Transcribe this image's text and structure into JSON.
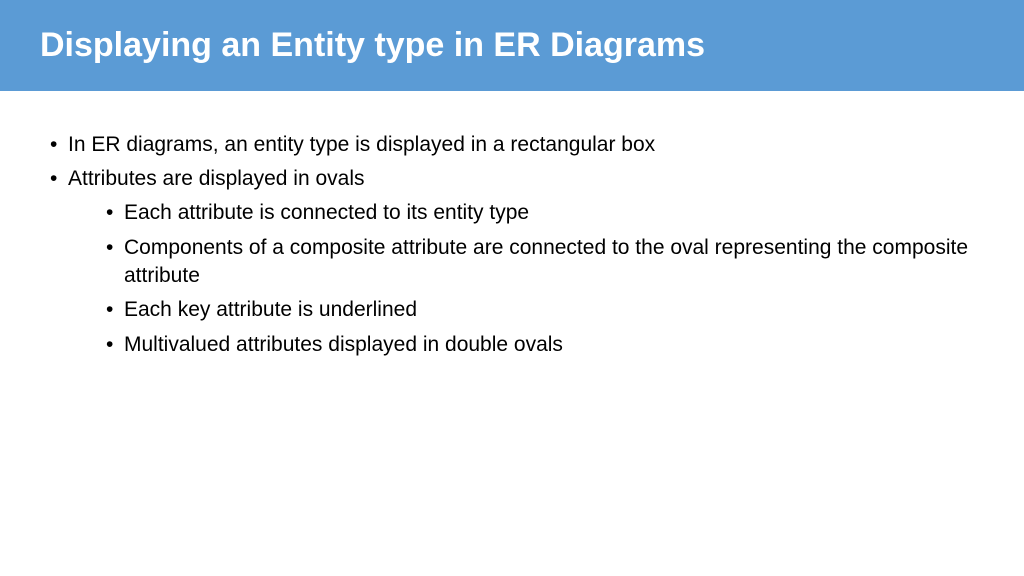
{
  "header": {
    "title": "Displaying an Entity type in ER Diagrams"
  },
  "content": {
    "bullets": [
      {
        "text": "In ER diagrams, an entity type is displayed in a rectangular box"
      },
      {
        "text": "Attributes are displayed in ovals",
        "subbullets": [
          "Each attribute is connected to its entity type",
          "Components of a composite attribute are connected to the oval representing the composite attribute",
          "Each key attribute is underlined",
          "Multivalued attributes displayed in double ovals"
        ]
      }
    ]
  }
}
